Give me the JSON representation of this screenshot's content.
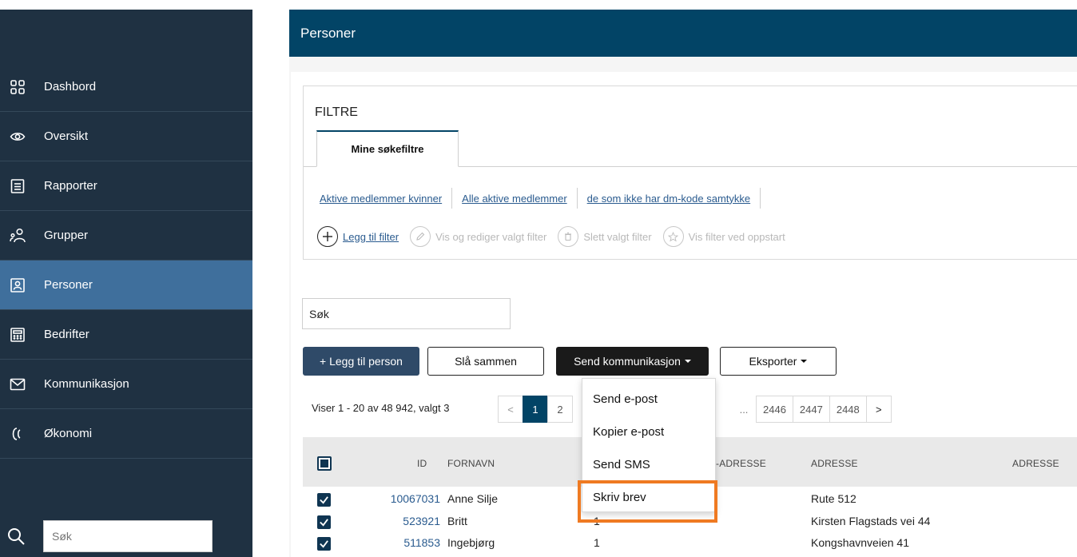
{
  "header": {
    "title": "Personer"
  },
  "sidebar": {
    "items": [
      {
        "label": "Dashbord",
        "icon": "grid-icon"
      },
      {
        "label": "Oversikt",
        "icon": "eye-icon"
      },
      {
        "label": "Rapporter",
        "icon": "document-icon"
      },
      {
        "label": "Grupper",
        "icon": "group-icon"
      },
      {
        "label": "Personer",
        "icon": "person-card-icon",
        "active": true
      },
      {
        "label": "Bedrifter",
        "icon": "calculator-icon"
      },
      {
        "label": "Kommunikasjon",
        "icon": "envelope-icon"
      },
      {
        "label": "Økonomi",
        "icon": "coin-icon"
      }
    ],
    "search_placeholder": "Søk"
  },
  "filters": {
    "title": "FILTRE",
    "tab_label": "Mine søkefiltre",
    "links": [
      "Aktive medlemmer kvinner",
      "Alle aktive medlemmer",
      "de som ikke har dm-kode samtykke"
    ],
    "actions": {
      "add": "Legg til filter",
      "edit": "Vis og rediger valgt filter",
      "delete": "Slett valgt filter",
      "startup": "Vis filter ved oppstart"
    }
  },
  "search": {
    "value": "Søk"
  },
  "buttons": {
    "add_person": "+ Legg til person",
    "merge": "Slå sammen",
    "send_comm": "Send kommunikasjon",
    "export": "Eksporter"
  },
  "pagination": {
    "showing": "Viser 1 - 20 av 48 942, valgt 3",
    "prev": "<",
    "next": ">",
    "page_1": "1",
    "page_2": "2",
    "ellipsis": "...",
    "page_2446": "2446",
    "page_2447": "2447",
    "page_2448": "2448"
  },
  "dropdown": {
    "items": [
      "Send e-post",
      "Kopier e-post",
      "Send SMS",
      "Skriv brev"
    ]
  },
  "table": {
    "headers": {
      "id": "ID",
      "fornavn": "FORNAVN",
      "epost_partial": "-ADRESSE",
      "adresse": "ADRESSE",
      "adresse2": "ADRESSE"
    },
    "rows": [
      {
        "id": "10067031",
        "fornavn": "Anne Silje",
        "col3": "",
        "adresse": "Rute 512"
      },
      {
        "id": "523921",
        "fornavn": "Britt",
        "col3": "1",
        "adresse": "Kirsten Flagstads vei 44"
      },
      {
        "id": "511853",
        "fornavn": "Ingebjørg",
        "col3": "1",
        "adresse": "Kongshavnveien 41"
      }
    ]
  },
  "colors": {
    "header": "#024466",
    "sidebar": "#1f3142",
    "active": "#3f6f9c",
    "highlight": "#ef7a22"
  }
}
